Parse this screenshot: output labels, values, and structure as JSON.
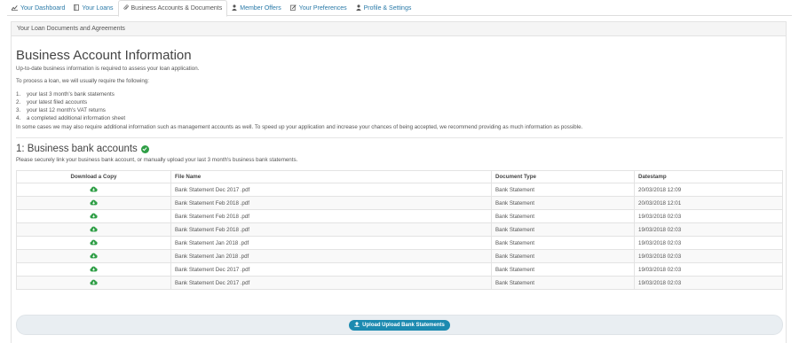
{
  "tabs": [
    {
      "label": "Your Dashboard",
      "icon": "chart-icon"
    },
    {
      "label": "Your Loans",
      "icon": "book-icon"
    },
    {
      "label": "Business Accounts & Documents",
      "icon": "paperclip-icon"
    },
    {
      "label": "Member Offers",
      "icon": "user-icon"
    },
    {
      "label": "Your Preferences",
      "icon": "edit-icon"
    },
    {
      "label": "Profile & Settings",
      "icon": "user-icon"
    }
  ],
  "panel": {
    "heading": "Your Loan Documents and Agreements"
  },
  "info": {
    "title": "Business Account Information",
    "intro": "Up-to-date business information is required to assess your loan application.",
    "process": "To process a loan, we will usually require the following:",
    "requirements": [
      {
        "n": "1.",
        "text": "your last 3 month's bank statements"
      },
      {
        "n": "2.",
        "text": "your latest filed accounts"
      },
      {
        "n": "3.",
        "text": "your last 12 month's VAT returns"
      },
      {
        "n": "4.",
        "text": "a completed additional information sheet"
      }
    ],
    "note": "In some cases we may also require additional information such as management accounts as well. To speed up your application and increase your chances of being accepted, we recommend providing as much information as possible."
  },
  "bank": {
    "title": "1: Business bank accounts",
    "subtitle": "Please securely link your business bank account, or manually upload your last 3 month's business bank statements.",
    "columns": [
      "Download a Copy",
      "File Name",
      "Document Type",
      "Datestamp"
    ],
    "rows": [
      {
        "file": "Bank Statement Dec 2017 .pdf",
        "type": "Bank Statement",
        "date": "20/03/2018 12:09"
      },
      {
        "file": "Bank Statement Feb 2018 .pdf",
        "type": "Bank Statement",
        "date": "20/03/2018 12:01"
      },
      {
        "file": "Bank Statement Feb 2018 .pdf",
        "type": "Bank Statement",
        "date": "19/03/2018 02:03"
      },
      {
        "file": "Bank Statement Feb 2018 .pdf",
        "type": "Bank Statement",
        "date": "19/03/2018 02:03"
      },
      {
        "file": "Bank Statement Jan 2018 .pdf",
        "type": "Bank Statement",
        "date": "19/03/2018 02:03"
      },
      {
        "file": "Bank Statement Jan 2018 .pdf",
        "type": "Bank Statement",
        "date": "19/03/2018 02:03"
      },
      {
        "file": "Bank Statement Dec 2017 .pdf",
        "type": "Bank Statement",
        "date": "19/03/2018 02:03"
      },
      {
        "file": "Bank Statement Dec 2017 .pdf",
        "type": "Bank Statement",
        "date": "19/03/2018 02:03"
      }
    ],
    "upload_label": "Upload Upload Bank Statements"
  },
  "colors": {
    "accent": "#1c8ab0",
    "success": "#2e9e45",
    "link": "#2a7aa8"
  }
}
